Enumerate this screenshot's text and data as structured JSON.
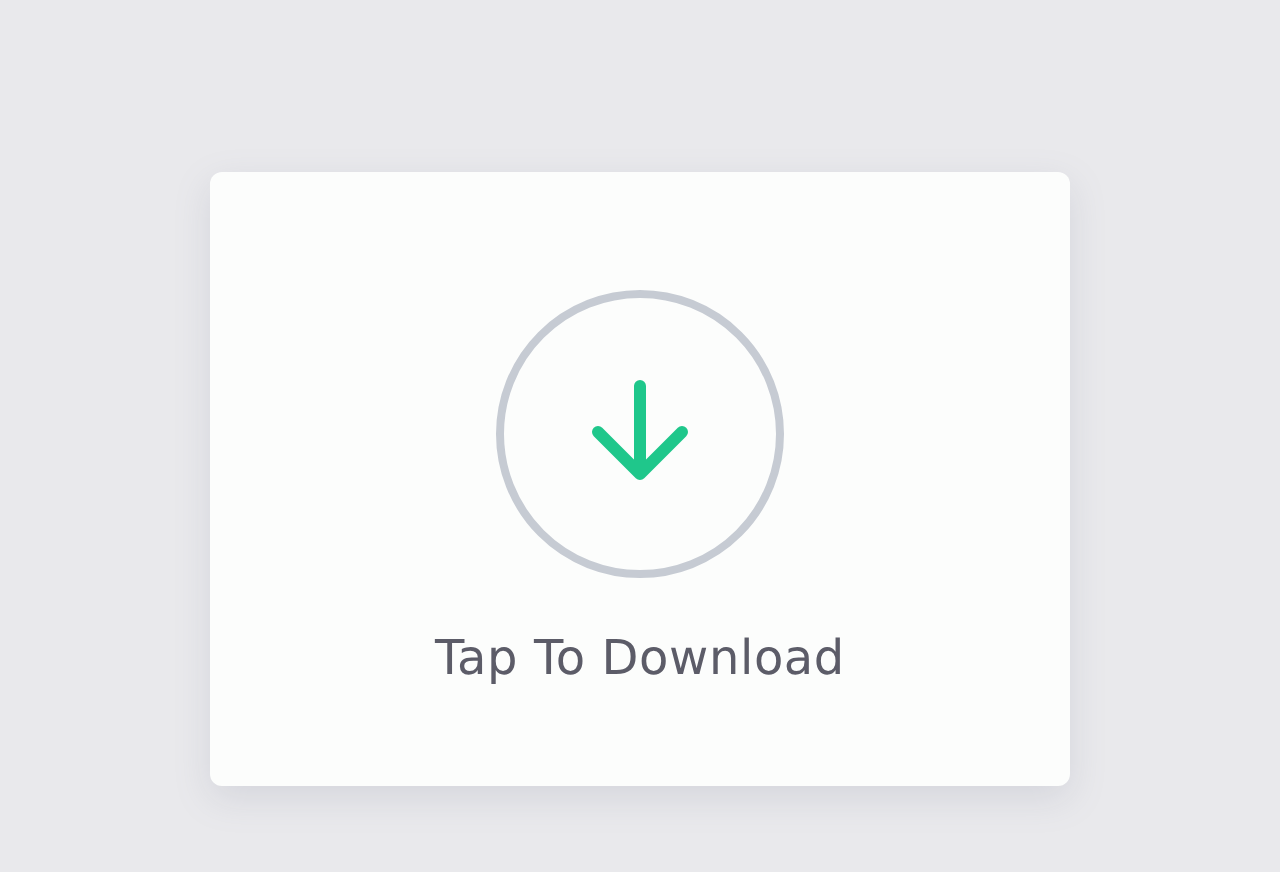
{
  "download_card": {
    "label": "Tap To Download"
  }
}
